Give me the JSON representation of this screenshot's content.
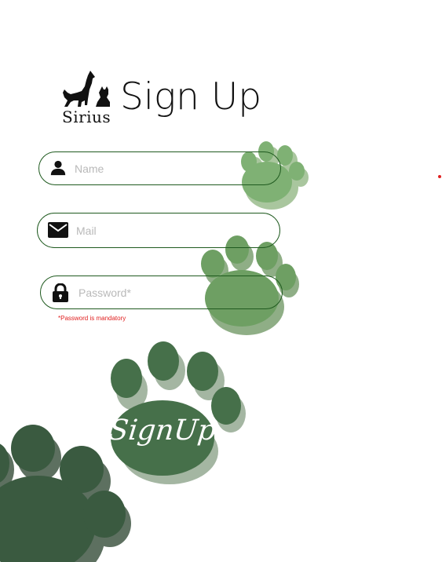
{
  "brand": {
    "name": "Sirius"
  },
  "page": {
    "title": "Sign Up"
  },
  "form": {
    "name": {
      "placeholder": "Name",
      "value": "",
      "icon": "person-icon"
    },
    "mail": {
      "placeholder": "Mail",
      "value": "",
      "icon": "mail-icon"
    },
    "password": {
      "placeholder": "Password*",
      "value": "",
      "icon": "lock-icon"
    },
    "password_hint": "*Password is mandatory",
    "submit_label": "SignUp"
  },
  "colors": {
    "accent_light": "#7fb174",
    "accent_mid": "#5f8f5a",
    "accent_dark": "#46704a",
    "accent_darkest": "#3a5a40",
    "error": "#e02020",
    "border": "#1f5a1f"
  }
}
